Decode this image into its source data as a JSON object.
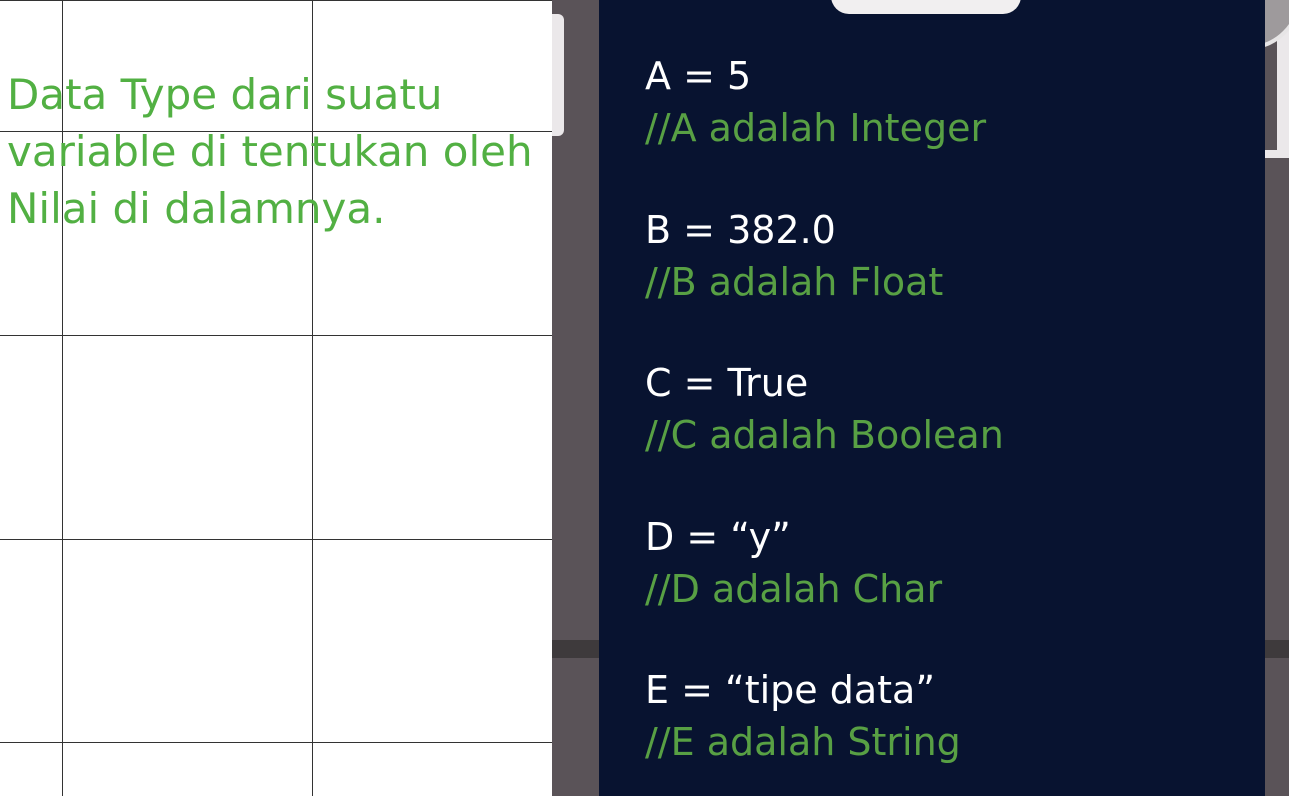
{
  "intro": {
    "text": "Data Type dari suatu\nvariable di tentukan oleh\nNilai di dalamnya."
  },
  "code": {
    "items": [
      {
        "statement": "A = 5",
        "comment": "//A adalah Integer"
      },
      {
        "statement": "B = 382.0",
        "comment": "//B adalah Float"
      },
      {
        "statement": "C = True",
        "comment": "//C adalah Boolean"
      },
      {
        "statement": "D = “y”",
        "comment": "//D adalah Char"
      },
      {
        "statement": "E = “tipe data”",
        "comment": "//E adalah String"
      }
    ]
  },
  "colors": {
    "intro_text": "#52b043",
    "panel_background": "#081330",
    "code_text": "#ffffff",
    "comment_text": "#58a044",
    "frame": "#5a5358"
  }
}
